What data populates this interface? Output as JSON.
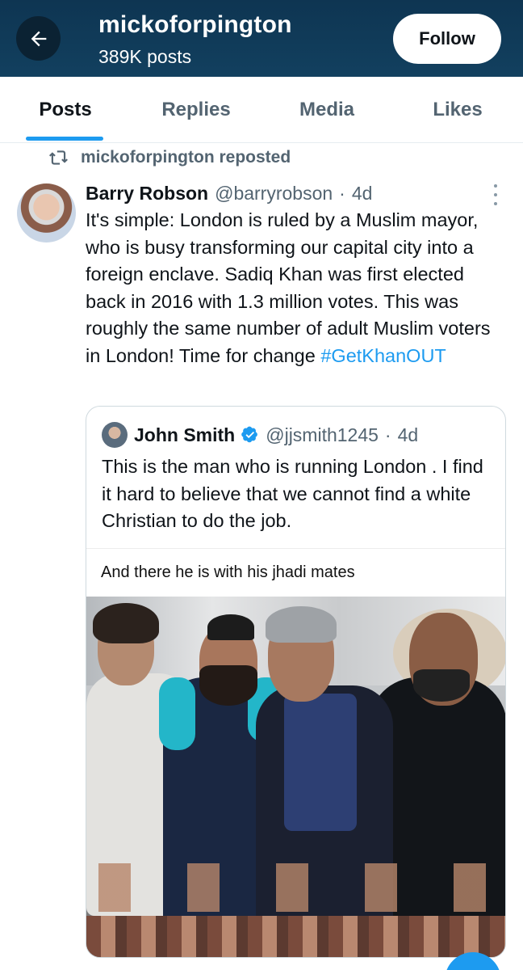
{
  "header": {
    "name": "mickoforpington",
    "post_count": "389K posts",
    "follow_label": "Follow"
  },
  "tabs": [
    {
      "label": "Posts",
      "active": true
    },
    {
      "label": "Replies",
      "active": false
    },
    {
      "label": "Media",
      "active": false
    },
    {
      "label": "Likes",
      "active": false
    }
  ],
  "repost": {
    "text": "mickoforpington reposted",
    "icon": "repost-icon"
  },
  "tweet": {
    "author_name": "Barry Robson",
    "author_handle": "@barryrobson",
    "separator": "·",
    "age": "4d",
    "text": "It's simple: London is ruled by a Muslim mayor, who is busy transforming our capital city into a foreign enclave. Sadiq Khan was first elected back in 2016 with 1.3 million votes. This was roughly the same number of adult Muslim voters in London! Time for change ",
    "hashtag": "#GetKhanOUT"
  },
  "quote": {
    "author_name": "John Smith",
    "author_handle": "@jjsmith1245",
    "separator": "·",
    "age": "4d",
    "text": "This is the man who is running London . I find it hard to believe that we cannot find a white Christian to do the job.",
    "media_caption": "And there he is with his jhadi mates"
  },
  "colors": {
    "header_bg": "#12405f",
    "accent": "#1d9bf0",
    "muted": "#536471",
    "verified": "#1d9bf0"
  }
}
